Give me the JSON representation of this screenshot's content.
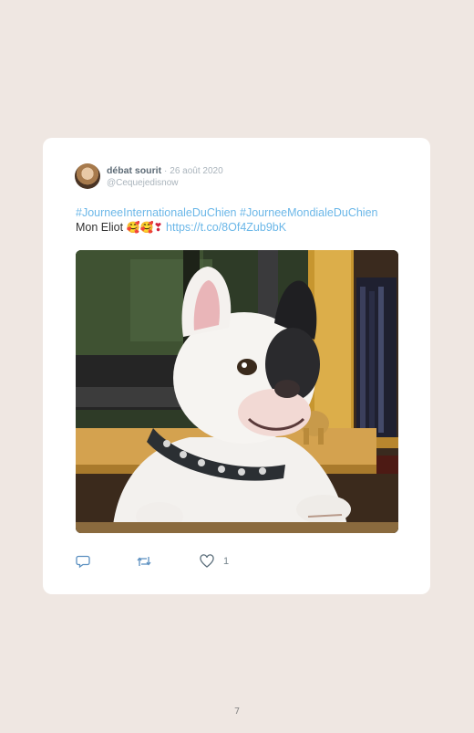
{
  "tweet": {
    "author_name": "débat sourit",
    "separator": "·",
    "date": "26 août 2020",
    "handle": "@Cequejedisnow",
    "hashtag_1": "#JourneeInternationaleDuChien",
    "hashtag_2": "#JourneeMondialeDuChien",
    "text_prefix": "Mon Eliot",
    "emoji_1": "🥰",
    "emoji_2": "🥰",
    "emoji_3": "❣",
    "link": "https://t.co/8Of4Zub9bK",
    "photo_icon": "french-bulldog-photo",
    "actions": {
      "reply_icon": "reply-icon",
      "retweet_icon": "retweet-icon",
      "like_icon": "heart-icon",
      "like_count": "1"
    }
  },
  "page_number": "7",
  "colors": {
    "background": "#efe7e2",
    "card": "#ffffff",
    "link": "#6bb7e8",
    "muted": "#aab4bc"
  }
}
